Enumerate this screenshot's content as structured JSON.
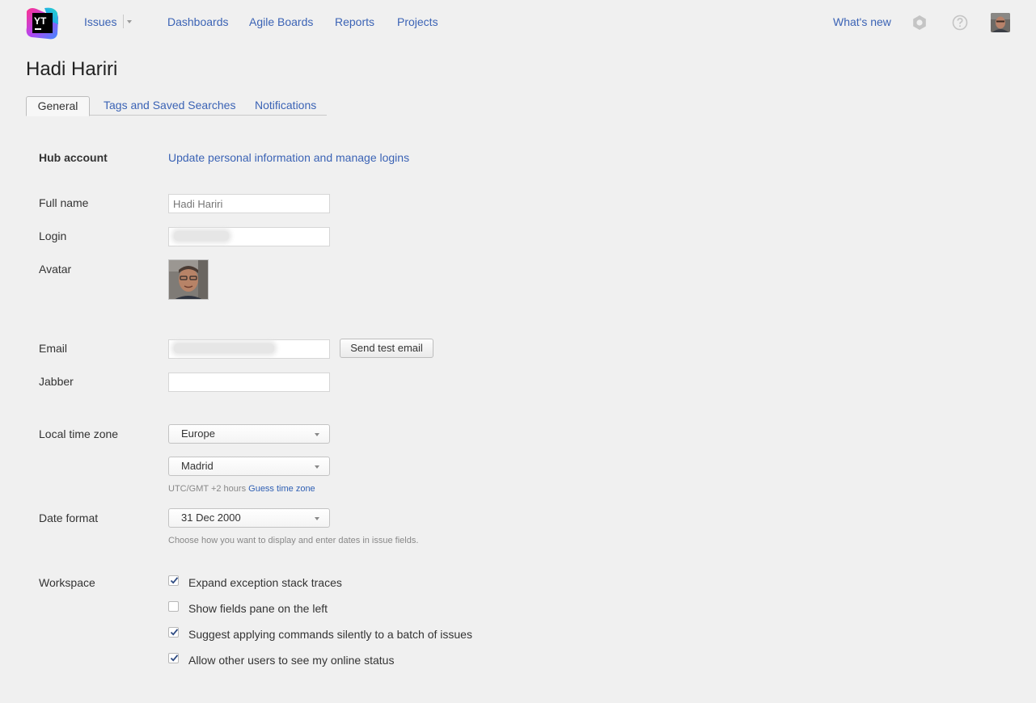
{
  "header": {
    "logo_text": "YT",
    "nav": {
      "issues": "Issues",
      "dashboards": "Dashboards",
      "agile_boards": "Agile Boards",
      "reports": "Reports",
      "projects": "Projects"
    },
    "whats_new": "What's new",
    "icons": [
      "settings-gear-icon",
      "help-icon",
      "user-avatar"
    ]
  },
  "page": {
    "title": "Hadi Hariri",
    "tabs": [
      {
        "label": "General",
        "active": true
      },
      {
        "label": "Tags and Saved Searches",
        "active": false
      },
      {
        "label": "Notifications",
        "active": false
      }
    ]
  },
  "form": {
    "hub_account": {
      "label": "Hub account",
      "link": "Update personal information and manage logins"
    },
    "full_name": {
      "label": "Full name",
      "placeholder": "Hadi Hariri"
    },
    "login": {
      "label": "Login"
    },
    "avatar": {
      "label": "Avatar"
    },
    "email": {
      "label": "Email",
      "button": "Send test email"
    },
    "jabber": {
      "label": "Jabber",
      "value": ""
    },
    "timezone": {
      "label": "Local time zone",
      "region": "Europe",
      "city": "Madrid",
      "offset_text": "UTC/GMT +2 hours",
      "guess_link": "Guess time zone"
    },
    "date_format": {
      "label": "Date format",
      "value": "31 Dec 2000",
      "hint": "Choose how you want to display and enter dates in issue fields."
    },
    "workspace": {
      "label": "Workspace",
      "options": [
        {
          "label": "Expand exception stack traces",
          "checked": true
        },
        {
          "label": "Show fields pane on the left",
          "checked": false
        },
        {
          "label": "Suggest applying commands silently to a batch of issues",
          "checked": true
        },
        {
          "label": "Allow other users to see my online status",
          "checked": true
        }
      ]
    }
  },
  "colors": {
    "link": "#3b63b5",
    "background": "#f0f0f0",
    "checkbox_check": "#2d4a82"
  }
}
